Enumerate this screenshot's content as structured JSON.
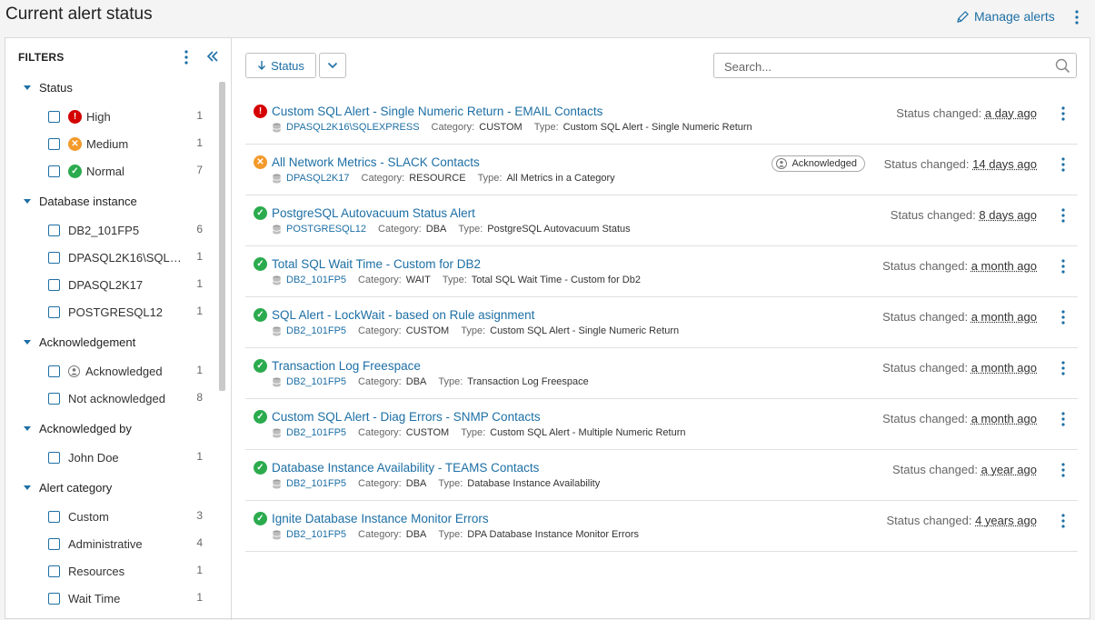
{
  "header": {
    "title": "Current alert status",
    "manage_label": "Manage alerts",
    "menu_icon": "kebab-icon"
  },
  "sidebar": {
    "title": "FILTERS",
    "groups": [
      {
        "label": "Status",
        "items": [
          {
            "label": "High",
            "count": "1",
            "icon": "high-status-icon"
          },
          {
            "label": "Medium",
            "count": "1",
            "icon": "medium-status-icon"
          },
          {
            "label": "Normal",
            "count": "7",
            "icon": "normal-status-icon"
          }
        ]
      },
      {
        "label": "Database instance",
        "items": [
          {
            "label": "DB2_101FP5",
            "count": "6"
          },
          {
            "label": "DPASQL2K16\\SQLEXPRESS",
            "count": "1"
          },
          {
            "label": "DPASQL2K17",
            "count": "1"
          },
          {
            "label": "POSTGRESQL12",
            "count": "1"
          }
        ]
      },
      {
        "label": "Acknowledgement",
        "items": [
          {
            "label": "Acknowledged",
            "count": "1",
            "icon": "acknowledged-icon"
          },
          {
            "label": "Not acknowledged",
            "count": "8"
          }
        ]
      },
      {
        "label": "Acknowledged by",
        "items": [
          {
            "label": "John Doe",
            "count": "1"
          }
        ]
      },
      {
        "label": "Alert category",
        "items": [
          {
            "label": "Custom",
            "count": "3"
          },
          {
            "label": "Administrative",
            "count": "4"
          },
          {
            "label": "Resources",
            "count": "1"
          },
          {
            "label": "Wait Time",
            "count": "1"
          }
        ]
      }
    ]
  },
  "toolbar": {
    "sort_label": "Status",
    "search_placeholder": "Search..."
  },
  "labels": {
    "category": "Category:",
    "type": "Type:",
    "status_changed": "Status changed:",
    "acknowledged": "Acknowledged"
  },
  "colors": {
    "accent": "#1d6fa5",
    "high": "#d50000",
    "medium": "#f39a2b",
    "normal": "#2bab4e"
  },
  "alerts": [
    {
      "name": "Custom SQL Alert - Single Numeric Return - EMAIL Contacts",
      "status": "high",
      "db": "DPASQL2K16\\SQLEXPRESS",
      "category": "CUSTOM",
      "type": "Custom SQL Alert - Single Numeric Return",
      "changed": "a day ago",
      "acknowledged": false
    },
    {
      "name": "All Network Metrics - SLACK Contacts",
      "status": "medium",
      "db": "DPASQL2K17",
      "category": "RESOURCE",
      "type": "All Metrics in a Category",
      "changed": "14 days ago",
      "acknowledged": true
    },
    {
      "name": "PostgreSQL Autovacuum Status Alert",
      "status": "normal",
      "db": "POSTGRESQL12",
      "category": "DBA",
      "type": "PostgreSQL Autovacuum Status",
      "changed": "8 days ago",
      "acknowledged": false
    },
    {
      "name": "Total SQL Wait Time - Custom for DB2",
      "status": "normal",
      "db": "DB2_101FP5",
      "category": "WAIT",
      "type": "Total SQL Wait Time - Custom for Db2",
      "changed": "a month ago",
      "acknowledged": false
    },
    {
      "name": "SQL Alert - LockWait - based on Rule asignment",
      "status": "normal",
      "db": "DB2_101FP5",
      "category": "CUSTOM",
      "type": "Custom SQL Alert - Single Numeric Return",
      "changed": "a month ago",
      "acknowledged": false
    },
    {
      "name": "Transaction Log Freespace",
      "status": "normal",
      "db": "DB2_101FP5",
      "category": "DBA",
      "type": "Transaction Log Freespace",
      "changed": "a month ago",
      "acknowledged": false
    },
    {
      "name": "Custom SQL Alert - Diag Errors - SNMP Contacts",
      "status": "normal",
      "db": "DB2_101FP5",
      "category": "CUSTOM",
      "type": "Custom SQL Alert - Multiple Numeric Return",
      "changed": "a month ago",
      "acknowledged": false
    },
    {
      "name": "Database Instance Availability - TEAMS Contacts",
      "status": "normal",
      "db": "DB2_101FP5",
      "category": "DBA",
      "type": "Database Instance Availability",
      "changed": "a year ago",
      "acknowledged": false
    },
    {
      "name": "Ignite Database Instance Monitor Errors",
      "status": "normal",
      "db": "DB2_101FP5",
      "category": "DBA",
      "type": "DPA Database Instance Monitor Errors",
      "changed": "4 years ago",
      "acknowledged": false
    }
  ]
}
